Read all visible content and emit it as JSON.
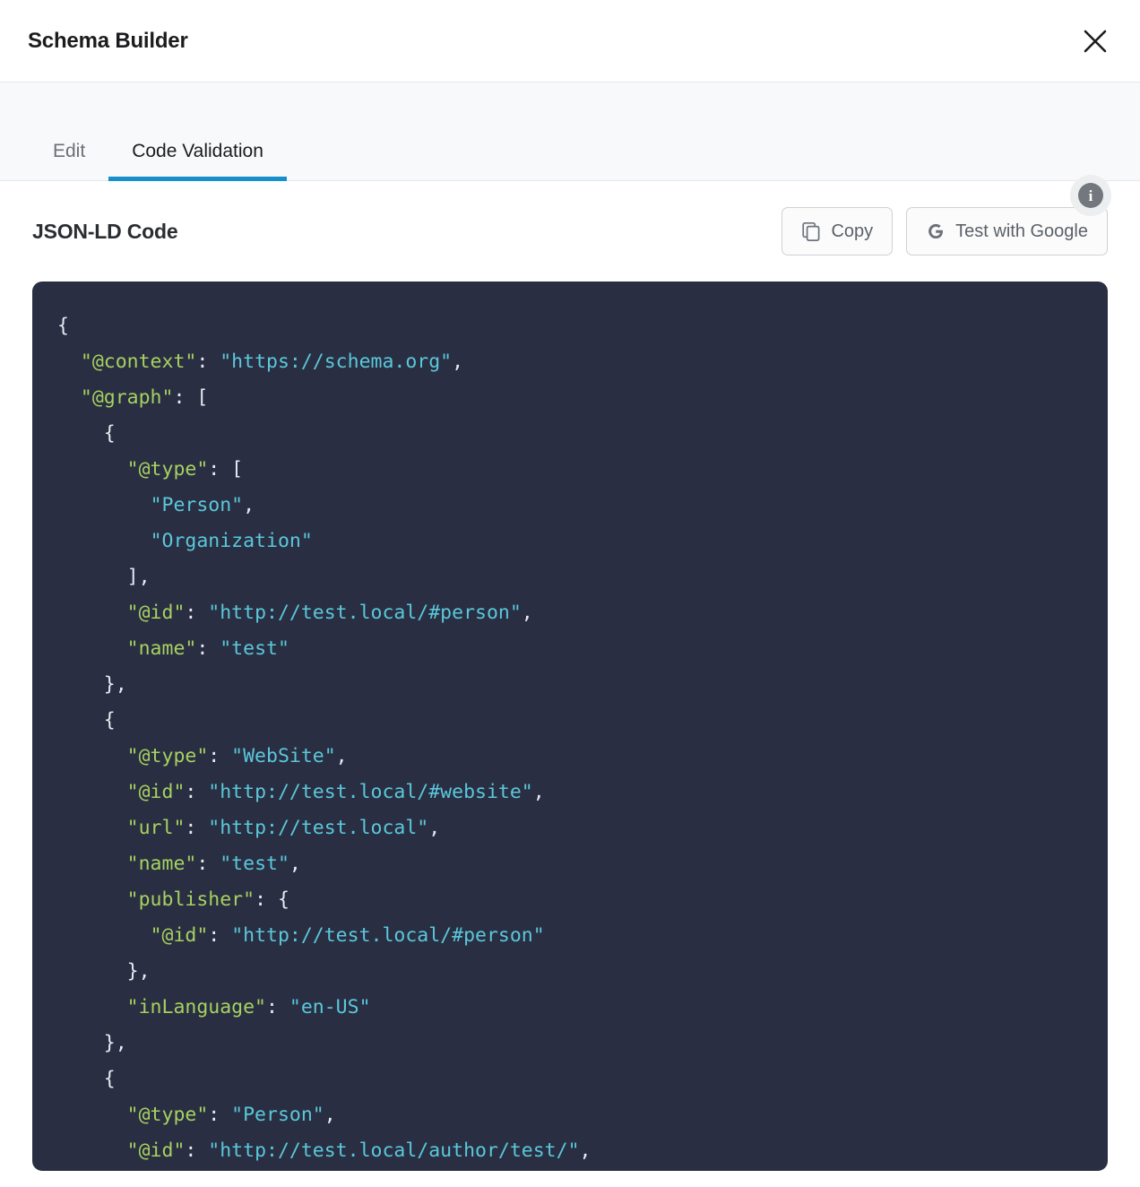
{
  "window": {
    "title": "Schema Builder",
    "close_icon": "close-icon"
  },
  "tabs": {
    "items": [
      {
        "label": "Edit",
        "active": false
      },
      {
        "label": "Code Validation",
        "active": true
      }
    ],
    "info_icon": "info-icon",
    "info_glyph": "i",
    "active_underline_color": "#1690cd"
  },
  "section": {
    "title": "JSON-LD Code",
    "buttons": [
      {
        "label": "Copy",
        "icon": "copy-icon"
      },
      {
        "label": "Test with Google",
        "icon": "google-g-icon"
      }
    ]
  },
  "code": {
    "language": "JSON-LD",
    "background_color": "#2a2e42",
    "key_color": "#a6d161",
    "string_color": "#5ac8da",
    "punctuation_color": "#e8ebf2",
    "lines": [
      [
        {
          "t": "p",
          "v": "{"
        }
      ],
      [
        {
          "t": "p",
          "v": "  "
        },
        {
          "t": "k",
          "v": "\"@context\""
        },
        {
          "t": "p",
          "v": ": "
        },
        {
          "t": "s",
          "v": "\"https://schema.org\""
        },
        {
          "t": "p",
          "v": ","
        }
      ],
      [
        {
          "t": "p",
          "v": "  "
        },
        {
          "t": "k",
          "v": "\"@graph\""
        },
        {
          "t": "p",
          "v": ": ["
        }
      ],
      [
        {
          "t": "p",
          "v": "    {"
        }
      ],
      [
        {
          "t": "p",
          "v": "      "
        },
        {
          "t": "k",
          "v": "\"@type\""
        },
        {
          "t": "p",
          "v": ": ["
        }
      ],
      [
        {
          "t": "p",
          "v": "        "
        },
        {
          "t": "s",
          "v": "\"Person\""
        },
        {
          "t": "p",
          "v": ","
        }
      ],
      [
        {
          "t": "p",
          "v": "        "
        },
        {
          "t": "s",
          "v": "\"Organization\""
        }
      ],
      [
        {
          "t": "p",
          "v": "      ],"
        }
      ],
      [
        {
          "t": "p",
          "v": "      "
        },
        {
          "t": "k",
          "v": "\"@id\""
        },
        {
          "t": "p",
          "v": ": "
        },
        {
          "t": "s",
          "v": "\"http://test.local/#person\""
        },
        {
          "t": "p",
          "v": ","
        }
      ],
      [
        {
          "t": "p",
          "v": "      "
        },
        {
          "t": "k",
          "v": "\"name\""
        },
        {
          "t": "p",
          "v": ": "
        },
        {
          "t": "s",
          "v": "\"test\""
        }
      ],
      [
        {
          "t": "p",
          "v": "    },"
        }
      ],
      [
        {
          "t": "p",
          "v": "    {"
        }
      ],
      [
        {
          "t": "p",
          "v": "      "
        },
        {
          "t": "k",
          "v": "\"@type\""
        },
        {
          "t": "p",
          "v": ": "
        },
        {
          "t": "s",
          "v": "\"WebSite\""
        },
        {
          "t": "p",
          "v": ","
        }
      ],
      [
        {
          "t": "p",
          "v": "      "
        },
        {
          "t": "k",
          "v": "\"@id\""
        },
        {
          "t": "p",
          "v": ": "
        },
        {
          "t": "s",
          "v": "\"http://test.local/#website\""
        },
        {
          "t": "p",
          "v": ","
        }
      ],
      [
        {
          "t": "p",
          "v": "      "
        },
        {
          "t": "k",
          "v": "\"url\""
        },
        {
          "t": "p",
          "v": ": "
        },
        {
          "t": "s",
          "v": "\"http://test.local\""
        },
        {
          "t": "p",
          "v": ","
        }
      ],
      [
        {
          "t": "p",
          "v": "      "
        },
        {
          "t": "k",
          "v": "\"name\""
        },
        {
          "t": "p",
          "v": ": "
        },
        {
          "t": "s",
          "v": "\"test\""
        },
        {
          "t": "p",
          "v": ","
        }
      ],
      [
        {
          "t": "p",
          "v": "      "
        },
        {
          "t": "k",
          "v": "\"publisher\""
        },
        {
          "t": "p",
          "v": ": {"
        }
      ],
      [
        {
          "t": "p",
          "v": "        "
        },
        {
          "t": "k",
          "v": "\"@id\""
        },
        {
          "t": "p",
          "v": ": "
        },
        {
          "t": "s",
          "v": "\"http://test.local/#person\""
        }
      ],
      [
        {
          "t": "p",
          "v": "      },"
        }
      ],
      [
        {
          "t": "p",
          "v": "      "
        },
        {
          "t": "k",
          "v": "\"inLanguage\""
        },
        {
          "t": "p",
          "v": ": "
        },
        {
          "t": "s",
          "v": "\"en-US\""
        }
      ],
      [
        {
          "t": "p",
          "v": "    },"
        }
      ],
      [
        {
          "t": "p",
          "v": "    {"
        }
      ],
      [
        {
          "t": "p",
          "v": "      "
        },
        {
          "t": "k",
          "v": "\"@type\""
        },
        {
          "t": "p",
          "v": ": "
        },
        {
          "t": "s",
          "v": "\"Person\""
        },
        {
          "t": "p",
          "v": ","
        }
      ],
      [
        {
          "t": "p",
          "v": "      "
        },
        {
          "t": "k",
          "v": "\"@id\""
        },
        {
          "t": "p",
          "v": ": "
        },
        {
          "t": "s",
          "v": "\"http://test.local/author/test/\""
        },
        {
          "t": "p",
          "v": ","
        }
      ]
    ]
  }
}
